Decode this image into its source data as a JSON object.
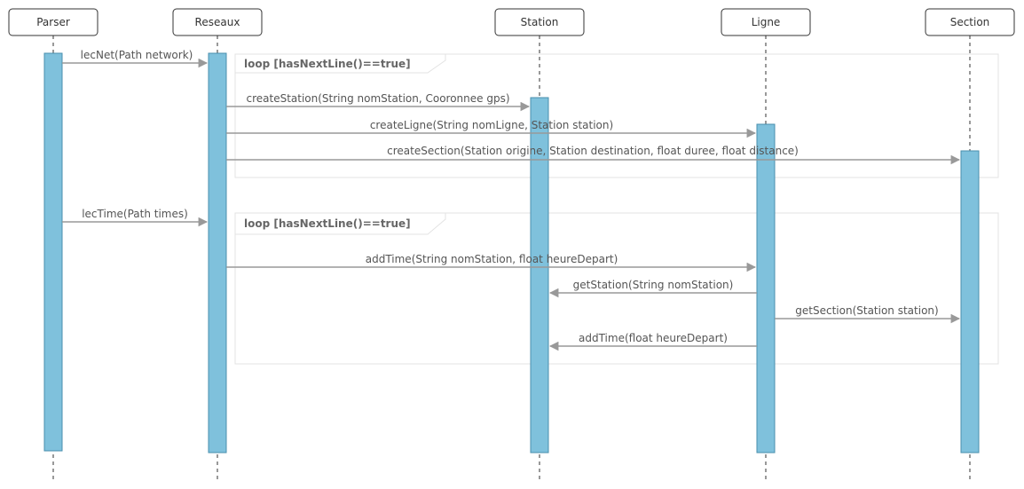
{
  "participants": [
    {
      "id": "parser",
      "label": "Parser"
    },
    {
      "id": "reseaux",
      "label": "Reseaux"
    },
    {
      "id": "station",
      "label": "Station"
    },
    {
      "id": "ligne",
      "label": "Ligne"
    },
    {
      "id": "section",
      "label": "Section"
    }
  ],
  "loops": [
    {
      "label": "loop [hasNextLine()==true]"
    },
    {
      "label": "loop [hasNextLine()==true]"
    }
  ],
  "messages": [
    {
      "from": "parser",
      "to": "reseaux",
      "label": "lecNet(Path network)"
    },
    {
      "from": "reseaux",
      "to": "station",
      "label": "createStation(String nomStation, Cooronnee gps)"
    },
    {
      "from": "reseaux",
      "to": "ligne",
      "label": "createLigne(String nomLigne, Station station)"
    },
    {
      "from": "reseaux",
      "to": "section",
      "label": "createSection(Station origine, Station destination, float duree, float distance)"
    },
    {
      "from": "parser",
      "to": "reseaux",
      "label": "lecTime(Path times)"
    },
    {
      "from": "reseaux",
      "to": "ligne",
      "label": "addTime(String nomStation, float heureDepart)"
    },
    {
      "from": "ligne",
      "to": "station",
      "label": "getStation(String nomStation)"
    },
    {
      "from": "ligne",
      "to": "section",
      "label": "getSection(Station station)"
    },
    {
      "from": "ligne",
      "to": "station",
      "label": "addTime(float heureDepart)"
    }
  ],
  "colors": {
    "activation": "#7fc1dc",
    "arrow": "#999999",
    "frame": "#e3e3e3"
  }
}
